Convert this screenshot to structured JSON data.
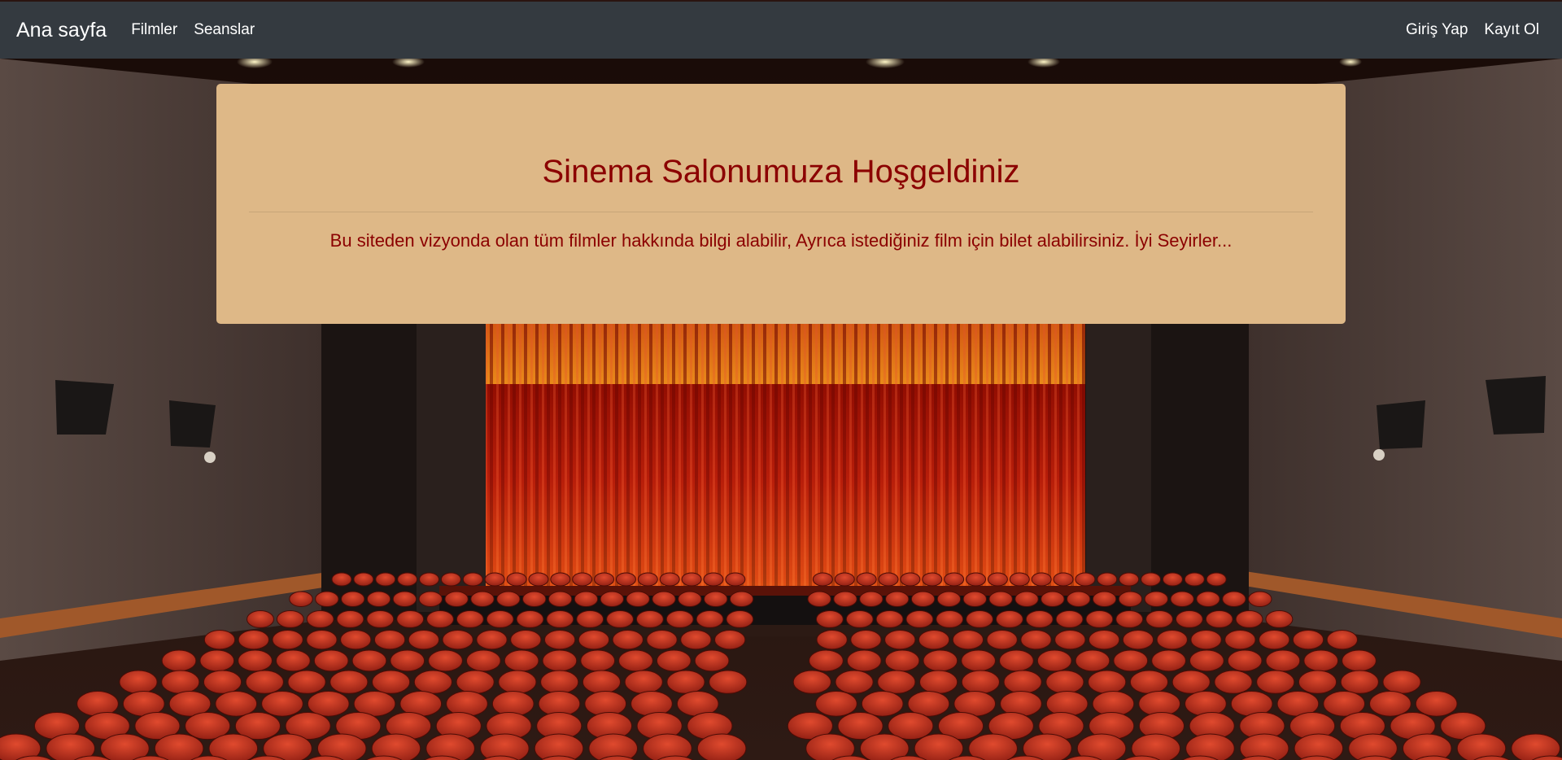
{
  "navbar": {
    "brand": "Ana sayfa",
    "links": [
      {
        "label": "Filmler"
      },
      {
        "label": "Seanslar"
      }
    ],
    "right_links": [
      {
        "label": "Giriş Yap"
      },
      {
        "label": "Kayıt Ol"
      }
    ]
  },
  "jumbotron": {
    "title": "Sinema Salonumuza Hoşgeldiniz",
    "lead": "Bu siteden vizyonda olan tüm filmler hakkında bilgi alabilir, Ayrıca istediğiniz film için bilet alabilirsiniz. İyi Seyirler..."
  },
  "colors": {
    "navbar_bg": "#343a40",
    "jumbotron_bg": "#deb887",
    "title_color": "#8b0000"
  }
}
